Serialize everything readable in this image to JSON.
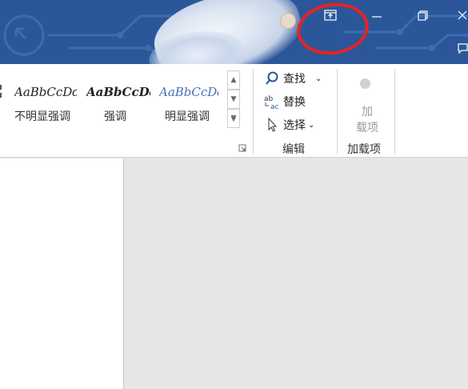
{
  "window_controls": {
    "ribbon_display_icon": "ribbon-display-options-icon",
    "minimize_icon": "minimize-icon",
    "restore_icon": "restore-icon",
    "close_icon": "close-icon",
    "comment_icon": "comment-icon"
  },
  "styles": {
    "items": [
      {
        "sample": "AaBbCcDd",
        "name": "不明显强调"
      },
      {
        "sample": "AaBbCcDd",
        "name": "强调"
      },
      {
        "sample": "AaBbCcDd",
        "name": "明显强调"
      }
    ]
  },
  "editing": {
    "find_label": "查找",
    "replace_label": "替换",
    "select_label": "选择",
    "group_label": "编辑"
  },
  "addins": {
    "button_line1": "加",
    "button_line2": "载项",
    "group_label": "加载项"
  },
  "colors": {
    "titlebar": "#2b579a",
    "annotation_circle": "#e8231f",
    "find_icon": "#2b579a",
    "sample_accent": "#4a72b5"
  }
}
